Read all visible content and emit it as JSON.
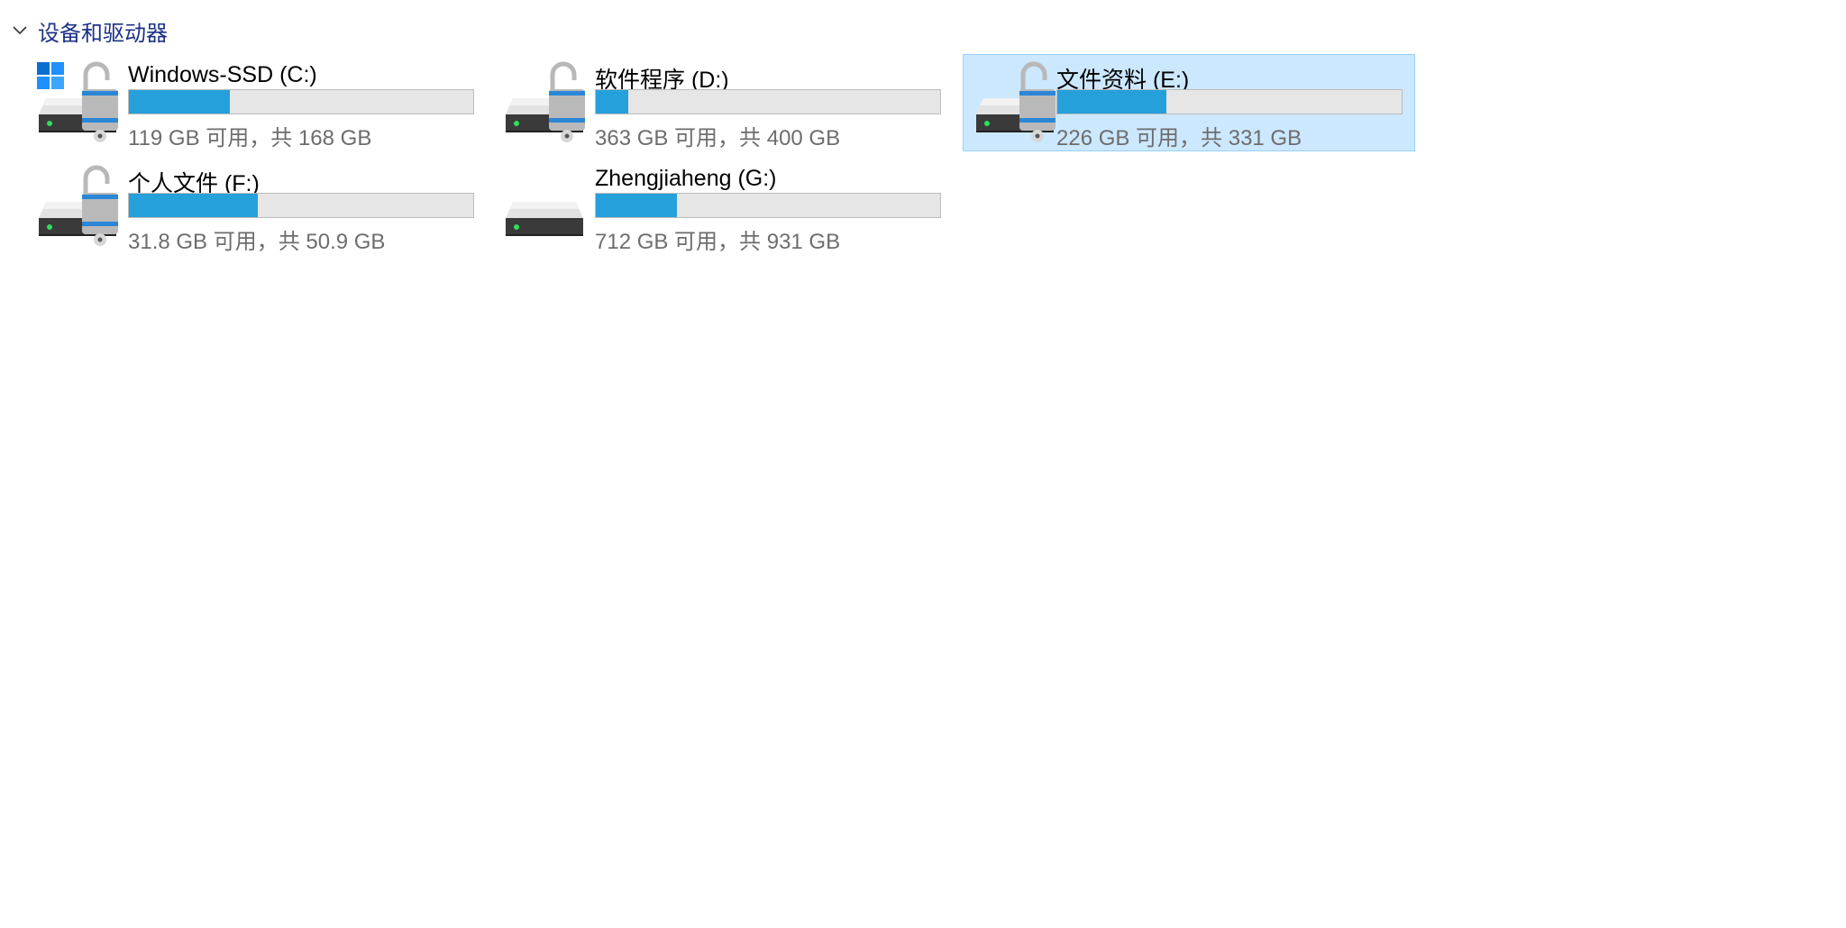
{
  "group": {
    "title": "设备和驱动器",
    "icon": "chevron-down-icon"
  },
  "drives": [
    {
      "name": "Windows-SSD (C:)",
      "info": "119 GB 可用，共 168 GB",
      "used_fraction": 0.292,
      "windows_logo": true,
      "lock": true,
      "selected": false
    },
    {
      "name": "软件程序 (D:)",
      "info": "363 GB 可用，共 400 GB",
      "used_fraction": 0.093,
      "windows_logo": false,
      "lock": true,
      "selected": false
    },
    {
      "name": "文件资料 (E:)",
      "info": "226 GB 可用，共 331 GB",
      "used_fraction": 0.317,
      "windows_logo": false,
      "lock": true,
      "selected": true
    },
    {
      "name": "个人文件 (F:)",
      "info": "31.8 GB 可用，共 50.9 GB",
      "used_fraction": 0.375,
      "windows_logo": false,
      "lock": true,
      "selected": false
    },
    {
      "name": "Zhengjiaheng (G:)",
      "info": "712 GB 可用，共 931 GB",
      "used_fraction": 0.235,
      "windows_logo": false,
      "lock": false,
      "selected": false
    }
  ],
  "colors": {
    "bar_fill": "#26a0da",
    "bar_track": "#e6e6e6",
    "selection_bg": "#cce8ff",
    "selection_border": "#99d1ff",
    "header_text": "#1e3287",
    "info_text": "#6d6d6d"
  }
}
